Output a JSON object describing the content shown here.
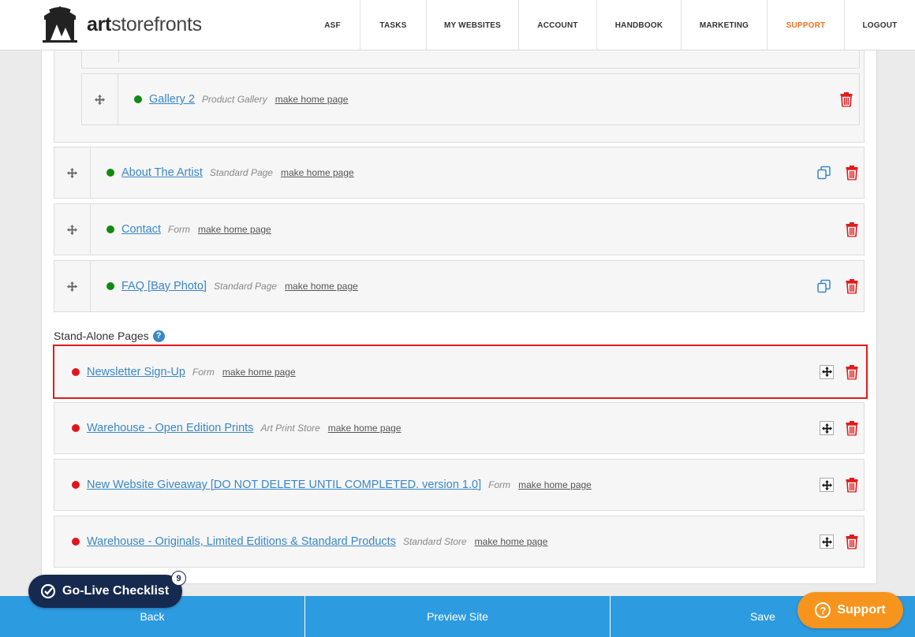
{
  "header": {
    "logo_text_bold": "art",
    "logo_text_rest": "storefronts",
    "nav": [
      "ASF",
      "TASKS",
      "MY WEBSITES",
      "ACCOUNT",
      "HANDBOOK",
      "MARKETING",
      "SUPPORT",
      "LOGOUT"
    ],
    "active_nav": "SUPPORT"
  },
  "nested_pages": [
    {
      "name": "Gallery 2",
      "type": "Product Gallery",
      "make_home": "make home page",
      "status": "green"
    }
  ],
  "pages": [
    {
      "name": "About The Artist",
      "type": "Standard Page",
      "make_home": "make home page",
      "status": "green"
    },
    {
      "name": "Contact",
      "type": "Form",
      "make_home": "make home page",
      "status": "green"
    },
    {
      "name": "FAQ [Bay Photo]",
      "type": "Standard Page",
      "make_home": "make home page",
      "status": "green"
    }
  ],
  "standalone": {
    "label": "Stand-Alone Pages",
    "help": "?",
    "items": [
      {
        "name": "Newsletter Sign-Up",
        "type": "Form",
        "make_home": "make home page",
        "status": "red"
      },
      {
        "name": "Warehouse - Open Edition Prints",
        "type": "Art Print Store",
        "make_home": "make home page",
        "status": "red"
      },
      {
        "name": "New Website Giveaway [DO NOT DELETE UNTIL COMPLETED. version 1.0]",
        "type": "Form",
        "make_home": "make home page",
        "status": "red"
      },
      {
        "name": "Warehouse - Originals, Limited Editions & Standard Products",
        "type": "Standard Store",
        "make_home": "make home page",
        "status": "red"
      }
    ]
  },
  "bottom": {
    "back": "Back",
    "preview": "Preview Site",
    "save": "Save"
  },
  "checklist": {
    "label": "Go-Live Checklist",
    "count": "9"
  },
  "support": {
    "label": "Support",
    "icon": "?"
  },
  "colors": {
    "accent": "#2d9be0",
    "link": "#3b87c7",
    "active_nav": "#f26f21",
    "support": "#f7941d",
    "checklist": "#16294f",
    "status_green": "#118a11",
    "status_red": "#e0161d"
  }
}
